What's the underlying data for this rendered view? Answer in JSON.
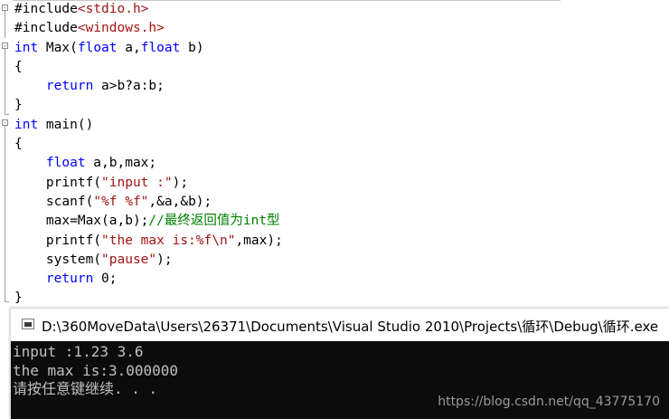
{
  "editor": {
    "lines": [
      {
        "parts": [
          {
            "t": "#include",
            "c": "plain"
          },
          {
            "t": "<stdio.h>",
            "c": "str"
          }
        ]
      },
      {
        "parts": [
          {
            "t": "#include",
            "c": "plain"
          },
          {
            "t": "<windows.h>",
            "c": "str"
          }
        ]
      },
      {
        "parts": [
          {
            "t": "int",
            "c": "kw"
          },
          {
            "t": " Max(",
            "c": "plain"
          },
          {
            "t": "float",
            "c": "kw"
          },
          {
            "t": " a,",
            "c": "plain"
          },
          {
            "t": "float",
            "c": "kw"
          },
          {
            "t": " b)",
            "c": "plain"
          }
        ]
      },
      {
        "parts": [
          {
            "t": "{",
            "c": "plain"
          }
        ]
      },
      {
        "parts": [
          {
            "t": "    ",
            "c": "plain"
          },
          {
            "t": "return",
            "c": "kw"
          },
          {
            "t": " a>b?a:b;",
            "c": "plain"
          }
        ]
      },
      {
        "parts": [
          {
            "t": "}",
            "c": "plain"
          }
        ]
      },
      {
        "parts": [
          {
            "t": "int",
            "c": "kw"
          },
          {
            "t": " main()",
            "c": "plain"
          }
        ]
      },
      {
        "parts": [
          {
            "t": "{",
            "c": "plain"
          }
        ]
      },
      {
        "parts": [
          {
            "t": "    ",
            "c": "plain"
          },
          {
            "t": "float",
            "c": "kw"
          },
          {
            "t": " a,b,max;",
            "c": "plain"
          }
        ]
      },
      {
        "parts": [
          {
            "t": "    printf(",
            "c": "plain"
          },
          {
            "t": "\"input :\"",
            "c": "str"
          },
          {
            "t": ");",
            "c": "plain"
          }
        ]
      },
      {
        "parts": [
          {
            "t": "    scanf(",
            "c": "plain"
          },
          {
            "t": "\"%f %f\"",
            "c": "str"
          },
          {
            "t": ",&a,&b);",
            "c": "plain"
          }
        ]
      },
      {
        "parts": [
          {
            "t": "    max=Max(a,b);",
            "c": "plain"
          },
          {
            "t": "//最终返回值为int型",
            "c": "cmt"
          }
        ]
      },
      {
        "parts": [
          {
            "t": "    printf(",
            "c": "plain"
          },
          {
            "t": "\"the max is:%f\\n\"",
            "c": "str"
          },
          {
            "t": ",max);",
            "c": "plain"
          }
        ]
      },
      {
        "parts": [
          {
            "t": "    system(",
            "c": "plain"
          },
          {
            "t": "\"pause\"",
            "c": "str"
          },
          {
            "t": ");",
            "c": "plain"
          }
        ]
      },
      {
        "parts": [
          {
            "t": "    ",
            "c": "plain"
          },
          {
            "t": "return",
            "c": "kw"
          },
          {
            "t": " 0;",
            "c": "plain"
          }
        ]
      },
      {
        "parts": [
          {
            "t": "}",
            "c": "plain"
          }
        ]
      }
    ],
    "fold_markers": [
      "-",
      "-",
      "-"
    ]
  },
  "console": {
    "title": "D:\\360MoveData\\Users\\26371\\Documents\\Visual Studio 2010\\Projects\\循环\\Debug\\循环.exe",
    "output_lines": [
      "input :1.23 3.6",
      "the max is:3.000000",
      "请按任意键继续. . ."
    ]
  },
  "watermark": "https://blog.csdn.net/qq_43775170",
  "colors": {
    "keyword": "#0000ff",
    "string": "#a31515",
    "comment": "#008000",
    "console_bg": "#0c0c0c",
    "console_text": "#c0c0c0"
  }
}
